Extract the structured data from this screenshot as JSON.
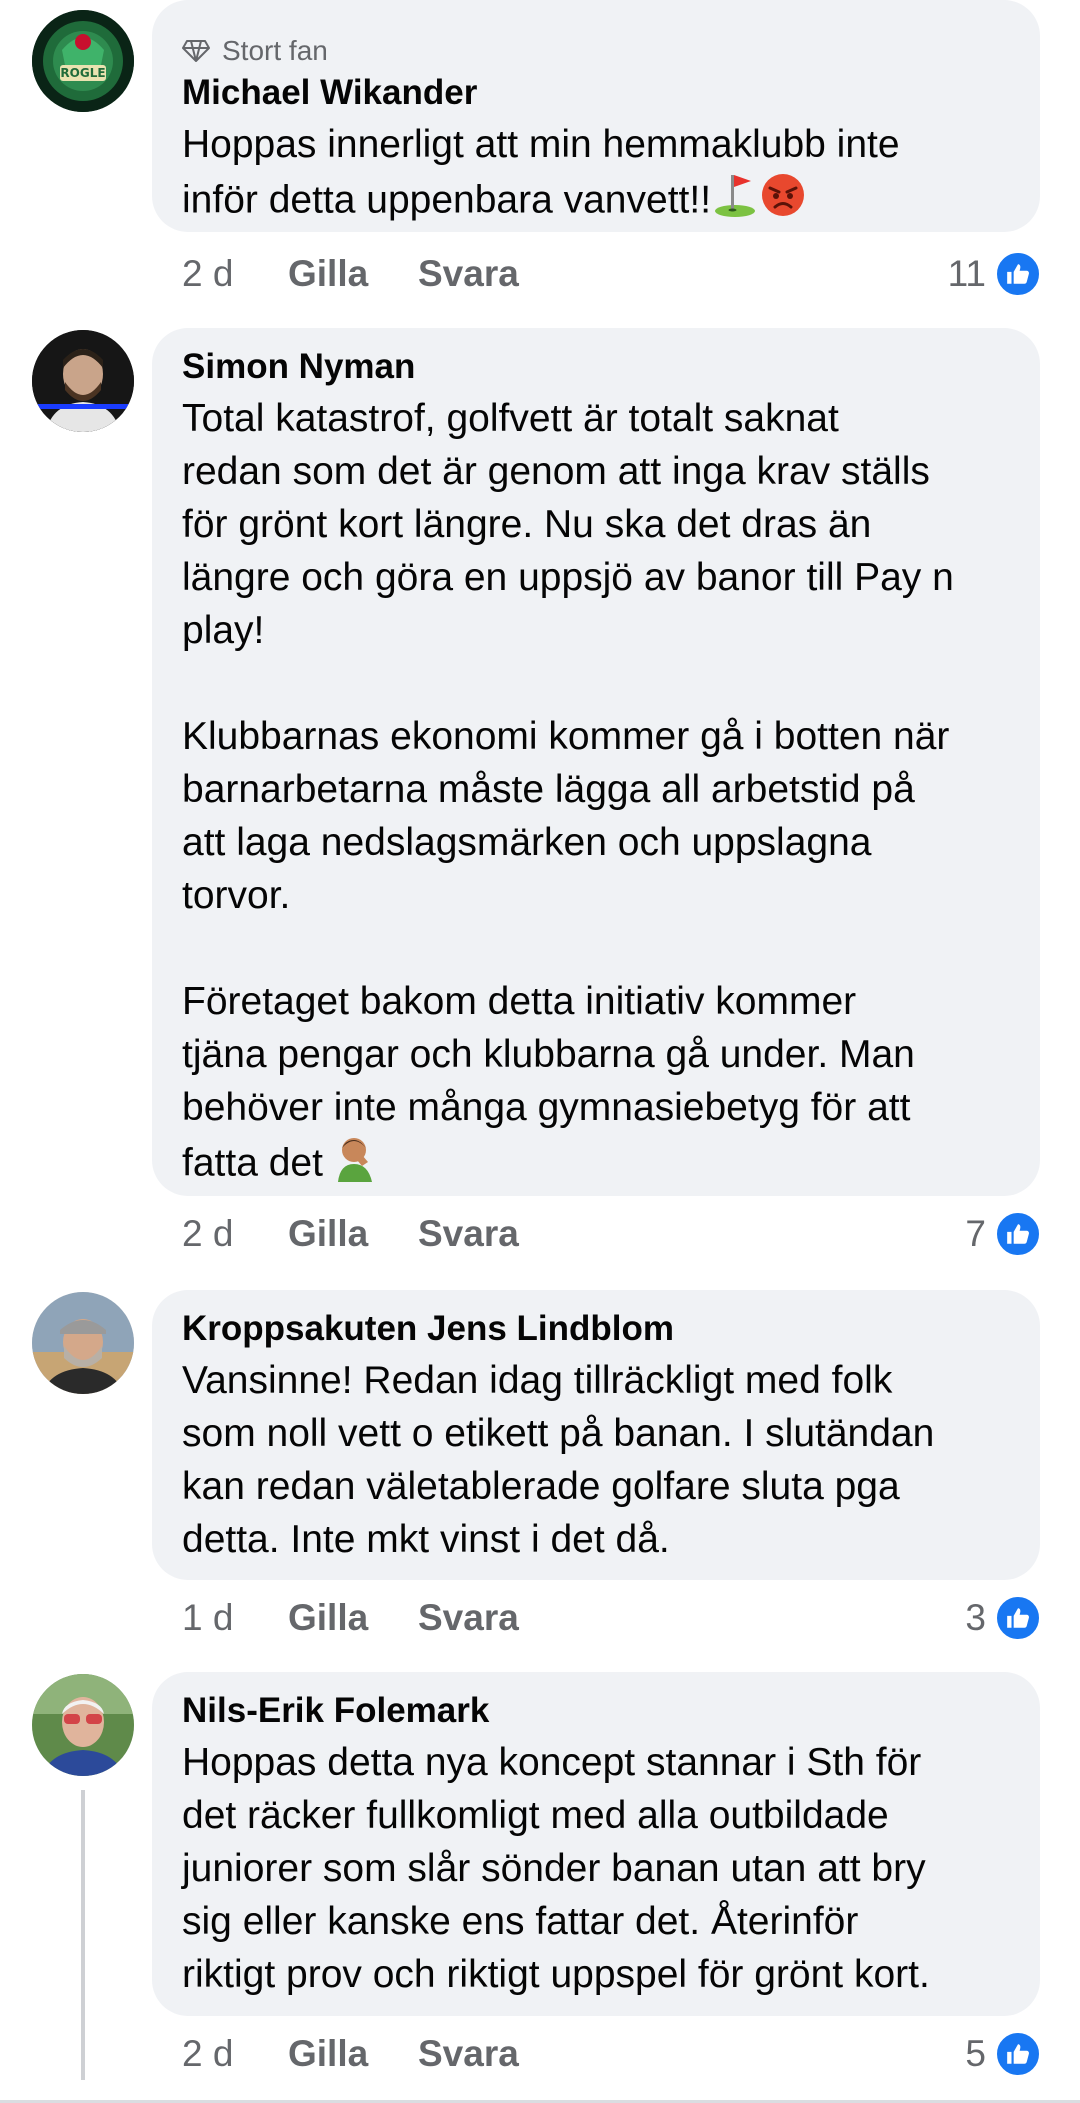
{
  "comments": [
    {
      "badge": "Stort fan",
      "name": "Michael Wikander",
      "text": "Hoppas innerligt att min hemmaklubb inte\ninför detta uppenbara vanvett!!",
      "time": "2 d",
      "like_label": "Gilla",
      "reply_label": "Svara",
      "reactions": "11"
    },
    {
      "name": "Simon Nyman",
      "text": "Total katastrof, golfvett är totalt saknat\nredan som det är genom att inga krav ställs\nför grönt kort längre. Nu ska det dras än\nlängre och göra en uppsjö av banor till Pay n\nplay!\n\nKlubbarnas ekonomi kommer gå i botten när\nbarnarbetarna måste lägga all arbetstid på\natt laga nedslagsmärken och uppslagna\ntorvor.\n\nFöretaget bakom detta initiativ kommer\ntjäna pengar och klubbarna gå under. Man\nbehöver inte många gymnasiebetyg för att\nfatta det",
      "time": "2 d",
      "like_label": "Gilla",
      "reply_label": "Svara",
      "reactions": "7"
    },
    {
      "name": "Kroppsakuten Jens Lindblom",
      "text": "Vansinne! Redan idag tillräckligt med folk\nsom noll vett o etikett på banan. I slutändan\nkan redan väletablerade golfare sluta pga\ndetta. Inte mkt vinst i det då.",
      "time": "1 d",
      "like_label": "Gilla",
      "reply_label": "Svara",
      "reactions": "3"
    },
    {
      "name": "Nils-Erik Folemark",
      "text": "Hoppas detta nya koncept stannar i Sth för\ndet räcker fullkomligt med alla outbildade\njuniorer som slår sönder banan utan att bry\nsig eller kanske ens fattar det. Återinför\nriktigt prov och riktigt uppspel för grönt kort.",
      "time": "2 d",
      "like_label": "Gilla",
      "reply_label": "Svara",
      "reactions": "5"
    }
  ],
  "colors": {
    "bubble": "#f0f2f5",
    "meta_text": "#65676b",
    "like_blue": "#1877f2"
  },
  "icons": [
    "diamond-icon",
    "golf-flag-emoji",
    "angry-face-emoji",
    "facepalm-emoji",
    "thumbs-up-icon"
  ]
}
